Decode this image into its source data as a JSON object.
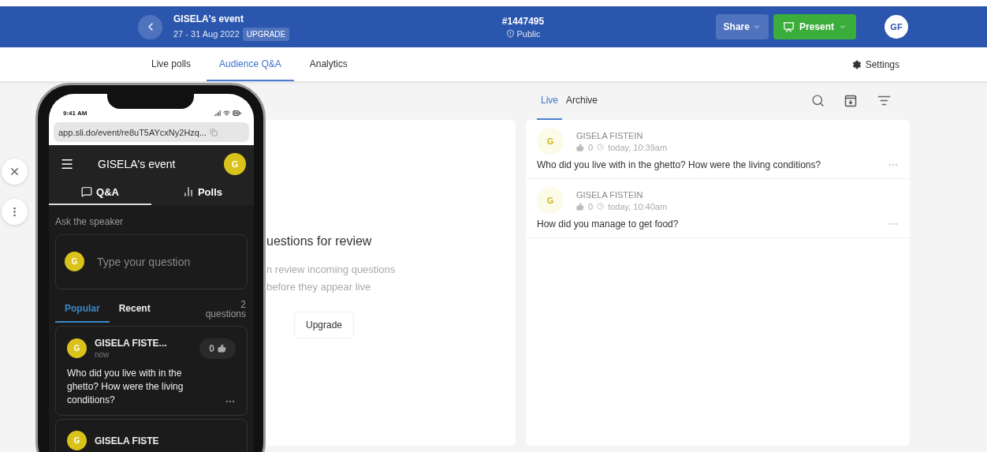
{
  "header": {
    "event_title": "GISELA's event",
    "dates": "27 - 31 Aug 2022",
    "upgrade_badge": "UPGRADE",
    "event_code": "#1447495",
    "visibility": "Public",
    "share_button": "Share",
    "present_button": "Present",
    "avatar": "GF"
  },
  "nav": {
    "tabs": [
      {
        "label": "Live polls",
        "selected": false
      },
      {
        "label": "Audience Q&A",
        "selected": true
      },
      {
        "label": "Analytics",
        "selected": false
      }
    ],
    "settings": "Settings"
  },
  "moderation_panel": {
    "heading": "uestions for review",
    "description_lines": [
      "n review incoming questions",
      "before they appear live"
    ],
    "upgrade_button": "Upgrade"
  },
  "questions_panel": {
    "tabs": [
      {
        "label": "Live",
        "selected": true
      },
      {
        "label": "Archive",
        "selected": false
      }
    ],
    "questions": [
      {
        "avatar": "G",
        "author": "GISELA FISTEIN",
        "likes": "0",
        "time": "today, 10:39am",
        "text": "Who did you live with in the ghetto? How were the living conditions?"
      },
      {
        "avatar": "G",
        "author": "GISELA FISTEIN",
        "likes": "0",
        "time": "today, 10:40am",
        "text": "How did you manage to get food?"
      }
    ]
  },
  "phone": {
    "status_time": "9:41 AM",
    "url": "app.sli.do/event/re8uT5AYcxNy2Hzq...",
    "app_title": "GISELA's event",
    "avatar": "G",
    "tabs": [
      {
        "label": "Q&A",
        "kind": "chat",
        "selected": true
      },
      {
        "label": "Polls",
        "kind": "bars",
        "selected": false
      }
    ],
    "prompt": "Ask the speaker",
    "input": {
      "avatar": "G",
      "placeholder": "Type your question"
    },
    "list_tabs": [
      {
        "label": "Popular",
        "selected": true
      },
      {
        "label": "Recent",
        "selected": false
      }
    ],
    "count": "2 questions",
    "cards": [
      {
        "avatar": "G",
        "author": "GISELA FISTE...",
        "time": "now",
        "likes": "0",
        "text": "Who did you live with in the ghetto? How were the living conditions?"
      },
      {
        "avatar": "G",
        "author": "GISELA FISTE"
      }
    ]
  }
}
